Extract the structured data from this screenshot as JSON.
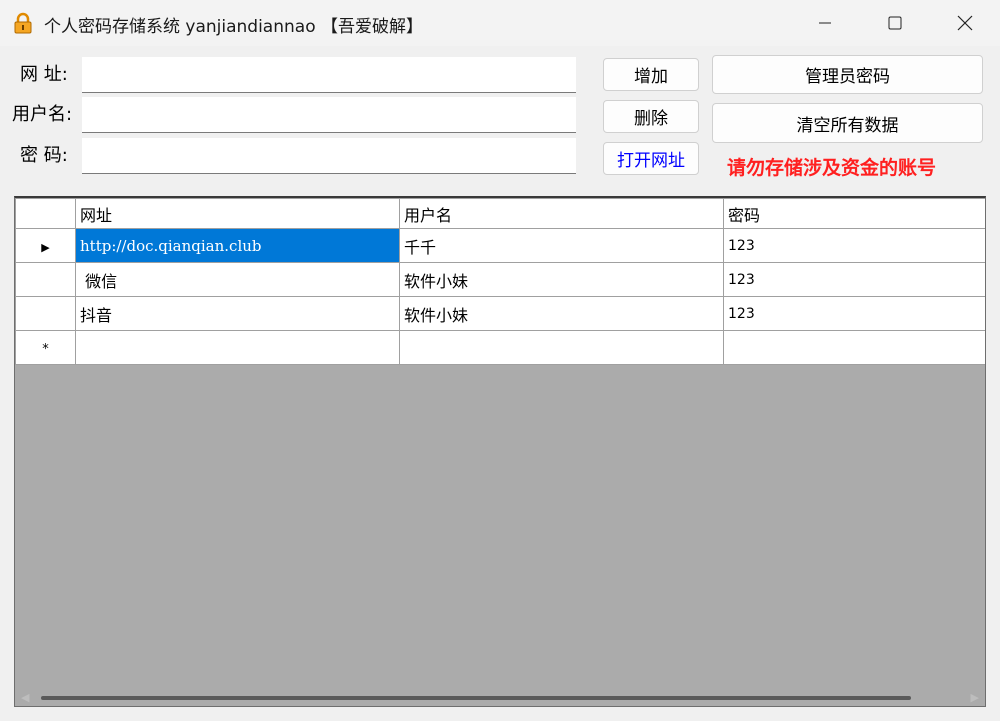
{
  "window": {
    "title": "个人密码存储系统 yanjiandiannao 【吾爱破解】",
    "icon": "padlock-icon",
    "controls": [
      "minimize-icon",
      "maximize-icon",
      "close-icon"
    ]
  },
  "form": {
    "url_label": "网 址:",
    "user_label": "用户名:",
    "pass_label": "密 码:",
    "url_value": "",
    "user_value": "",
    "pass_value": ""
  },
  "buttons": {
    "add": "增加",
    "delete": "删除",
    "open_url": "打开网址",
    "admin_password": "管理员密码",
    "clear_all": "清空所有数据"
  },
  "warning": "请勿存储涉及资金的账号",
  "colors": {
    "warning": "#ff2020",
    "selection": "#0078d7",
    "link_button": "#0000ff"
  },
  "grid": {
    "columns": [
      "网址",
      "用户名",
      "密码"
    ],
    "rows": [
      {
        "url": "http://doc.qianqian.club",
        "user": "千千",
        "pass": "123",
        "current": true
      },
      {
        "url": " 微信",
        "user": "软件小妹",
        "pass": "123"
      },
      {
        "url": "抖音",
        "user": "软件小妹",
        "pass": "123"
      }
    ],
    "current_row_marker": "▶",
    "new_row_marker": "*"
  }
}
